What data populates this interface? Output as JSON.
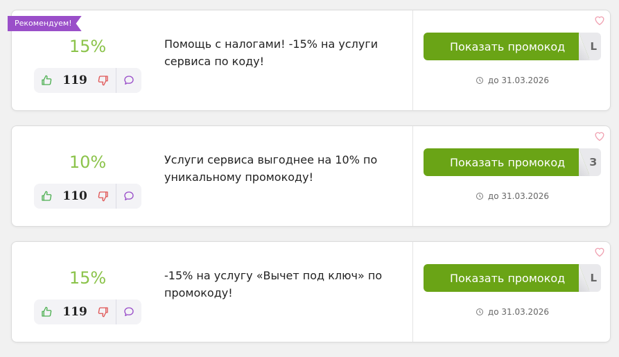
{
  "ribbon_label": "Рекомендуем!",
  "colors": {
    "accent_green": "#6aa416",
    "discount_green": "#8bc34a",
    "ribbon_purple": "#9a4fc9",
    "heart_pink": "#f0a0b0"
  },
  "offers": [
    {
      "discount": "15%",
      "votes": "119",
      "description": "Помощь с налогами! -15% на услуги сервиса по коду!",
      "button_label": "Показать промокод",
      "code_hint": "L",
      "expiry": "до 31.03.2026"
    },
    {
      "discount": "10%",
      "votes": "110",
      "description": "Услуги сервиса выгоднее на 10% по уникальному промокоду!",
      "button_label": "Показать промокод",
      "code_hint": "З",
      "expiry": "до 31.03.2026"
    },
    {
      "discount": "15%",
      "votes": "119",
      "description": "-15% на услугу «Вычет под ключ» по промокоду!",
      "button_label": "Показать промокод",
      "code_hint": "L",
      "expiry": "до 31.03.2026"
    }
  ]
}
